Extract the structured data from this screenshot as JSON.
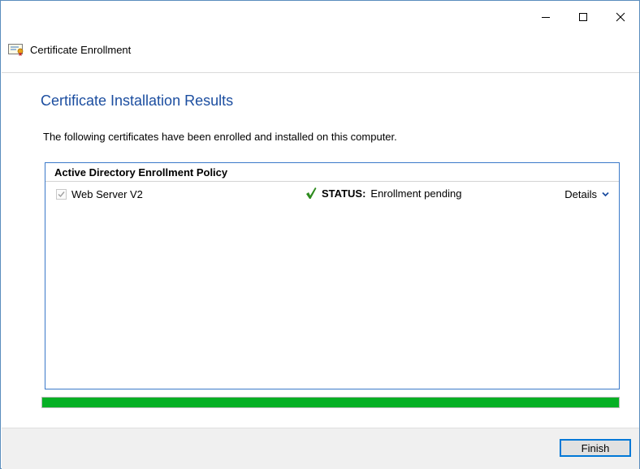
{
  "window": {
    "title": "Certificate Enrollment",
    "caption_icons": [
      "minimize-icon",
      "maximize-icon",
      "close-icon"
    ]
  },
  "page": {
    "heading": "Certificate Installation Results",
    "description": "The following certificates have been enrolled and installed on this computer."
  },
  "results": {
    "policy_name": "Active Directory Enrollment Policy",
    "certificates": [
      {
        "checked": true,
        "name": "Web Server V2",
        "status_label": "STATUS:",
        "status_value": "Enrollment pending",
        "details_label": "Details"
      }
    ]
  },
  "progress": {
    "percent": 100,
    "color": "#06b025"
  },
  "footer": {
    "finish_label": "Finish"
  },
  "colors": {
    "heading": "#1c4ea0",
    "panel_border": "#3b79c9",
    "status_check": "#2e8b1e",
    "details_chevron": "#1c4ea0",
    "button_border": "#0078d7"
  }
}
